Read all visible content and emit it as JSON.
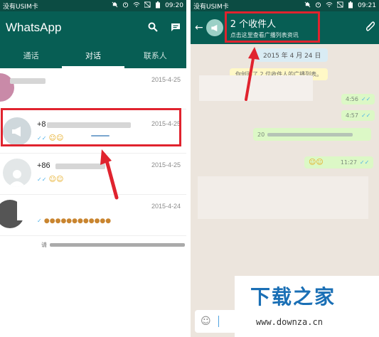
{
  "left": {
    "status": {
      "carrier": "没有USIM卡",
      "time": "09:20"
    },
    "app_title": "WhatsApp",
    "tabs": [
      "通话",
      "对话",
      "联系人"
    ],
    "chats": [
      {
        "name": "",
        "time": "2015-4-25",
        "preview": ""
      },
      {
        "name": "+8",
        "time": "2015-4-25",
        "preview": ""
      },
      {
        "name": "+86",
        "time": "2015-4-25",
        "preview": ""
      },
      {
        "name": "",
        "time": "2015-4-24",
        "preview": ""
      }
    ],
    "footer": "请"
  },
  "right": {
    "status": {
      "carrier": "没有USIM卡",
      "time": "09:21"
    },
    "title": "2 个收件人",
    "subtitle": "点击这里查看广播列表资讯",
    "date_pill": "2015 年 4 月 24 日",
    "system_message": "你创建了 2 位收件人的广播列表。",
    "messages": [
      {
        "text": "",
        "time": "4:56"
      },
      {
        "text": "",
        "time": "4:57"
      },
      {
        "text": "20",
        "time": ""
      },
      {
        "text": "",
        "time": "11:27"
      }
    ]
  },
  "watermark": {
    "cn": "下载之家",
    "url": "www.downza.cn"
  },
  "colors": {
    "header": "#075e54",
    "status": "#0c4c43",
    "highlight": "#e0232e",
    "bubble": "#dcf8c6",
    "wallpaper": "#ece5dd",
    "tick": "#4fb3e8"
  }
}
